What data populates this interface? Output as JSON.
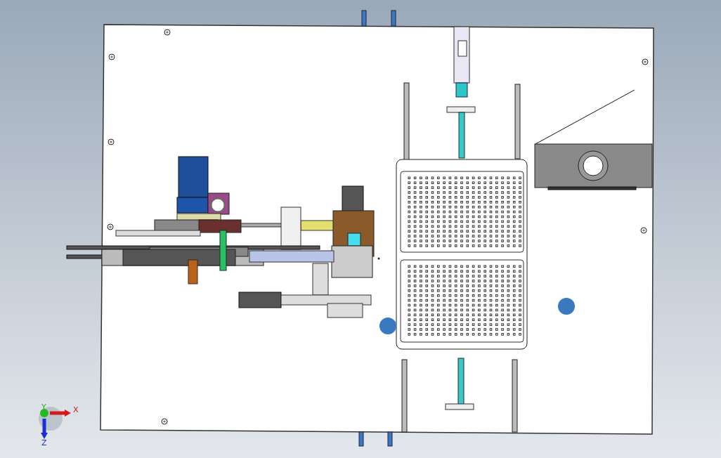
{
  "viewport": {
    "triad": {
      "axes": [
        {
          "kind": "x",
          "label": "X",
          "color": "#d41a1a"
        },
        {
          "kind": "y",
          "label": "Y",
          "color": "#22bb22"
        },
        {
          "kind": "z",
          "label": "Z",
          "color": "#1a2fd4"
        }
      ]
    }
  }
}
